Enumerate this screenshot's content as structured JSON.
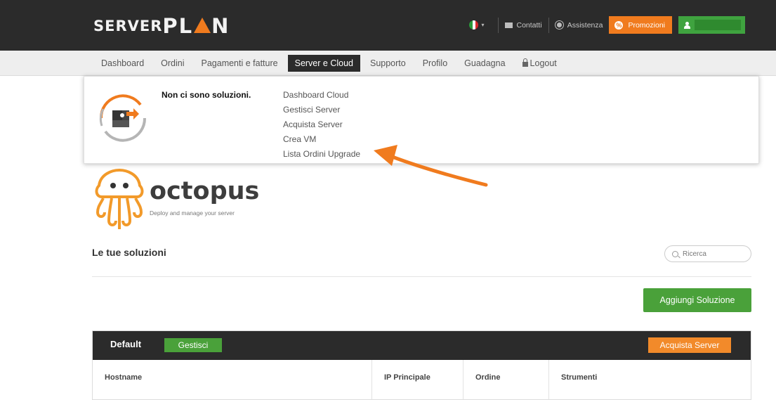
{
  "header": {
    "logo": {
      "part1": "SERVER",
      "part2a": "PL",
      "part2b": "N"
    },
    "language_caret": "▾",
    "contacts_label": "Contatti",
    "support_label": "Assistenza",
    "promo_label": "Promozioni",
    "promo_icon_glyph": "%"
  },
  "nav": {
    "items": [
      {
        "label": "Dashboard"
      },
      {
        "label": "Ordini"
      },
      {
        "label": "Pagamenti e fatture"
      },
      {
        "label": "Server e Cloud"
      },
      {
        "label": "Supporto"
      },
      {
        "label": "Profilo"
      },
      {
        "label": "Guadagna"
      },
      {
        "label": "Logout"
      }
    ]
  },
  "dropdown": {
    "empty_message": "Non ci sono soluzioni.",
    "links": [
      {
        "label": "Dashboard Cloud"
      },
      {
        "label": "Gestisci Server"
      },
      {
        "label": "Acquista Server"
      },
      {
        "label": "Crea VM"
      },
      {
        "label": "Lista Ordini Upgrade"
      }
    ]
  },
  "octopus": {
    "word": "octopus",
    "tagline": "Deploy and manage your server"
  },
  "solutions": {
    "title": "Le tue soluzioni",
    "search_placeholder": "Ricerca",
    "add_button": "Aggiungi Soluzione"
  },
  "group": {
    "name": "Default",
    "manage_button": "Gestisci",
    "buy_button": "Acquista Server",
    "columns": [
      "Hostname",
      "IP Principale",
      "Ordine",
      "Strumenti"
    ]
  },
  "colors": {
    "accent_orange": "#f07b1e",
    "accent_green": "#4aa13a",
    "dark": "#2b2b2b"
  }
}
